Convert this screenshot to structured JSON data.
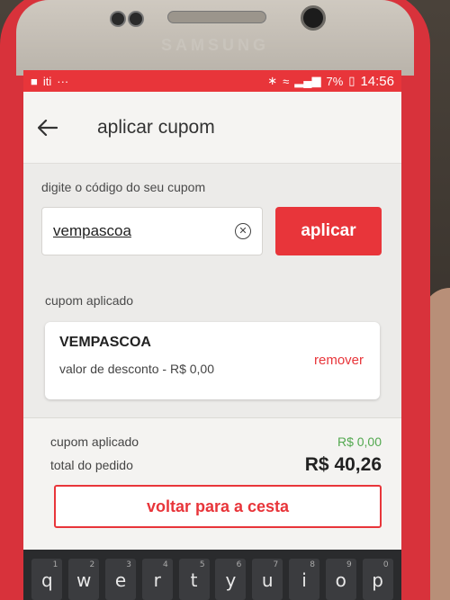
{
  "device": {
    "brand": "SAMSUNG"
  },
  "status_bar": {
    "left_app": "iti",
    "left_dots": "···",
    "battery": "7%",
    "time": "14:56"
  },
  "header": {
    "back_icon": "arrow-left-icon",
    "title": "aplicar cupom"
  },
  "coupon_entry": {
    "label": "digite o código do seu cupom",
    "value": "vempascoa",
    "clear_icon": "close-circle-icon",
    "apply_label": "aplicar"
  },
  "applied": {
    "label": "cupom aplicado",
    "code": "VEMPASCOA",
    "discount_text": "valor de desconto - R$ 0,00",
    "remove_label": "remover"
  },
  "summary": {
    "coupon_label": "cupom aplicado",
    "coupon_value": "R$ 0,00",
    "total_label": "total do pedido",
    "total_value": "R$ 40,26",
    "back_button": "voltar para a cesta"
  },
  "keyboard": {
    "keys": [
      {
        "char": "q",
        "hint": "1"
      },
      {
        "char": "w",
        "hint": "2"
      },
      {
        "char": "e",
        "hint": "3"
      },
      {
        "char": "r",
        "hint": "4"
      },
      {
        "char": "t",
        "hint": "5"
      },
      {
        "char": "y",
        "hint": "6"
      },
      {
        "char": "u",
        "hint": "7"
      },
      {
        "char": "i",
        "hint": "8"
      },
      {
        "char": "o",
        "hint": "9"
      },
      {
        "char": "p",
        "hint": "0"
      }
    ]
  },
  "colors": {
    "accent": "#e8353a",
    "discount_green": "#52a84f",
    "case": "#d8323b"
  }
}
